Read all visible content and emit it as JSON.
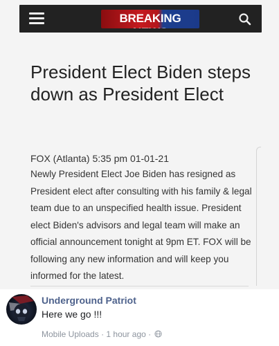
{
  "article": {
    "masthead": {
      "brand_text": "BREAKING NEWS",
      "brand_colors": {
        "red": "#c51a1f",
        "blue": "#1b3a8a"
      }
    },
    "headline": "President Elect Biden steps down as President Elect",
    "byline": "FOX (Atlanta) 5:35 pm 01-01-21",
    "body": "Newly President Elect Joe Biden has resigned as President elect after consulting with his family & legal team due to an unspecified health issue. President elect Biden's advisors and legal team will make an official announcement tonight at 9pm ET. FOX will be following any new information and will keep you informed for the latest."
  },
  "post": {
    "author": "Underground Patriot",
    "comment": "Here we go !!!",
    "source": "Mobile Uploads",
    "separator": "·",
    "time": "1 hour ago",
    "privacy_icon": "globe-icon",
    "author_color": "#4e628c"
  }
}
